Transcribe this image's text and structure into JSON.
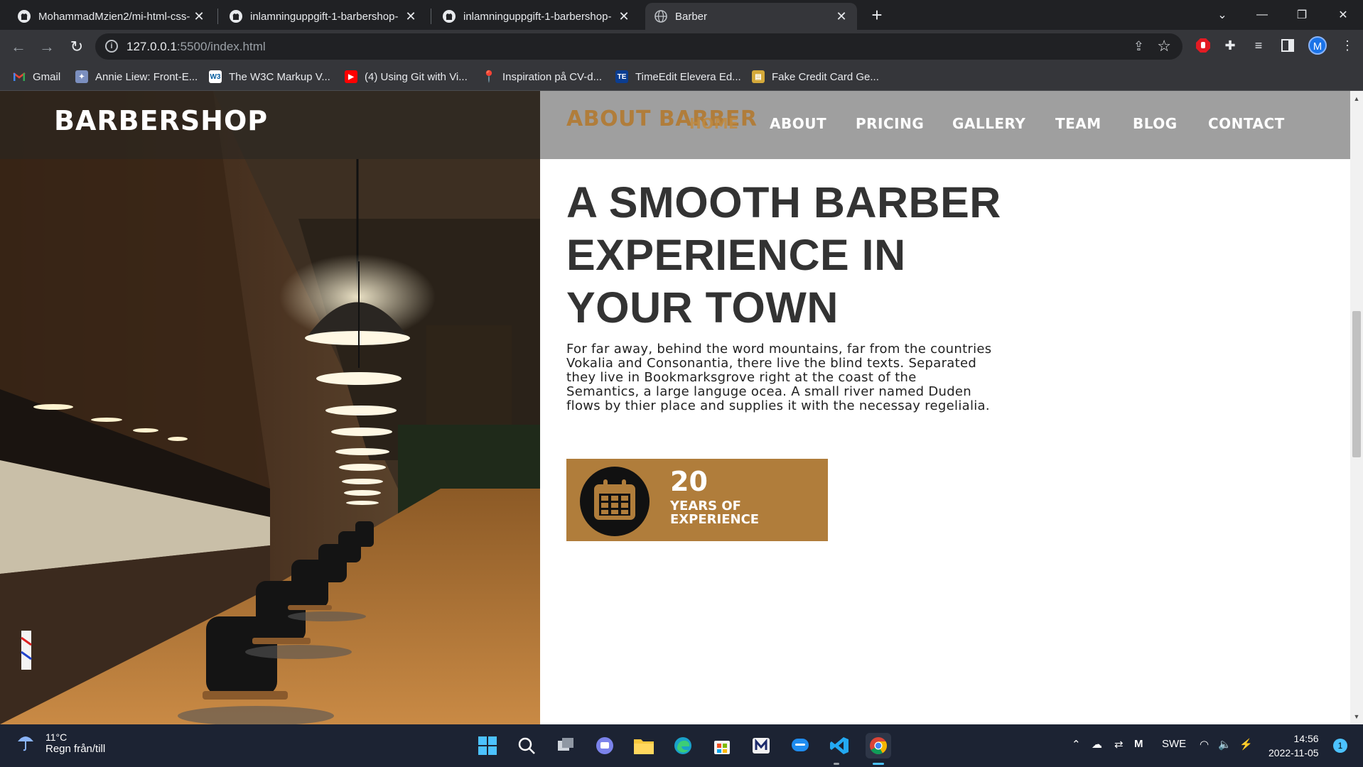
{
  "browser": {
    "tabs": [
      {
        "title": "MohammadMzien2/mi-html-css-",
        "icon": "github-icon",
        "active": false
      },
      {
        "title": "inlamninguppgift-1-barbershop-",
        "icon": "github-icon",
        "active": false
      },
      {
        "title": "inlamninguppgift-1-barbershop-",
        "icon": "github-icon",
        "active": false
      },
      {
        "title": "Barber",
        "icon": "globe-icon",
        "active": true
      }
    ],
    "new_tab": "+",
    "close": "✕",
    "url_host": "127.0.0.1",
    "url_path": ":5500/index.html",
    "profile_initial": "M",
    "bookmarks": [
      {
        "label": "Gmail",
        "icon": "gmail-icon",
        "color": "#ea4335"
      },
      {
        "label": "Annie Liew: Front-E...",
        "icon": "feather-icon",
        "color": "#7b8fbf"
      },
      {
        "label": "The W3C Markup V...",
        "icon": "w3c-icon",
        "color": "#ffffff"
      },
      {
        "label": "(4) Using Git with Vi...",
        "icon": "youtube-icon",
        "color": "#ff0000"
      },
      {
        "label": "Inspiration på CV-d...",
        "icon": "pin-icon",
        "color": "#e53935"
      },
      {
        "label": "TimeEdit Elevera Ed...",
        "icon": "timeedit-icon",
        "color": "#0b3d91"
      },
      {
        "label": "Fake Credit Card Ge...",
        "icon": "card-icon",
        "color": "#d4a93a"
      }
    ]
  },
  "site": {
    "logo": "BARBERSHOP",
    "about_ghost": "ABOUT BARBER",
    "nav": [
      "HOME",
      "ABOUT",
      "PRICING",
      "GALLERY",
      "TEAM",
      "BLOG",
      "CONTACT"
    ],
    "headline": "A SMOOTH BARBER EXPERIENCE IN YOUR TOWN",
    "body": "For far away, behind the word mountains, far from the countries Vokalia and Consonantia, there live the blind texts. Separated they live in Bookmarksgrove right at the coast of the Semantics, a large languge ocea. A small river named Duden flows by thier place and supplies it with the necessay regelialia.",
    "years_number": "20",
    "years_label": "YEARS OF EXPERIENCE",
    "accent_color": "#b07d3b",
    "header_color": "#9f9f9f"
  },
  "taskbar": {
    "temperature": "11°C",
    "condition": "Regn från/till",
    "language": "SWE",
    "time": "14:56",
    "date": "2022-11-05",
    "notifications": "1"
  }
}
